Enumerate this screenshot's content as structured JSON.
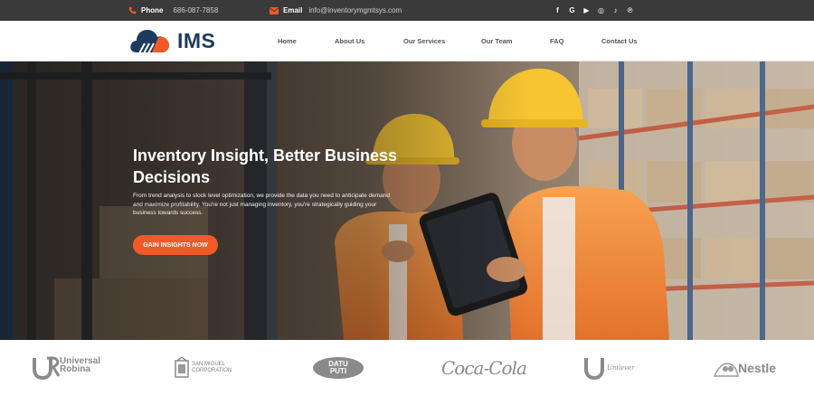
{
  "topbar": {
    "phone_label": "Phone",
    "phone_value": "686-087-7858",
    "email_label": "Email",
    "email_value": "info@inventorymgmtsys.com",
    "social_icons": [
      "facebook-icon",
      "google-icon",
      "youtube-icon",
      "instagram-icon",
      "tiktok-icon",
      "pinterest-icon"
    ],
    "social_glyphs": [
      "f",
      "G",
      "▶",
      "◎",
      "♪",
      "℗"
    ]
  },
  "header": {
    "logo_text": "IMS",
    "nav": [
      "Home",
      "About Us",
      "Our Services",
      "Our Team",
      "FAQ",
      "Contact Us"
    ]
  },
  "hero": {
    "title": "Inventory Insight, Better Business Decisions",
    "description": "From trend analysis to stock level optimization, we provide the data you need to anticipate demand and maximize profitability. You're not just managing inventory, you're strategically guiding your business towards success.",
    "cta_label": "GAIN INSIGHTS NOW"
  },
  "partners": {
    "logos": [
      {
        "icon": "universal-robina-logo",
        "lines": [
          "Universal",
          "Robina"
        ]
      },
      {
        "icon": "san-miguel-logo",
        "lines": [
          "SAN MIGUEL",
          "CORPORATION"
        ]
      },
      {
        "icon": "datu-puti-logo",
        "lines": [
          "DATU",
          "PUTI"
        ]
      },
      {
        "icon": "coca-cola-logo",
        "lines": [
          "Coca-Cola"
        ]
      },
      {
        "icon": "unilever-logo",
        "lines": [
          "Unilever"
        ]
      },
      {
        "icon": "nestle-logo",
        "lines": [
          "Nestle"
        ]
      }
    ]
  },
  "colors": {
    "accent": "#f05a28",
    "brand": "#1e3a5f",
    "topbar": "#3a3a3a"
  }
}
